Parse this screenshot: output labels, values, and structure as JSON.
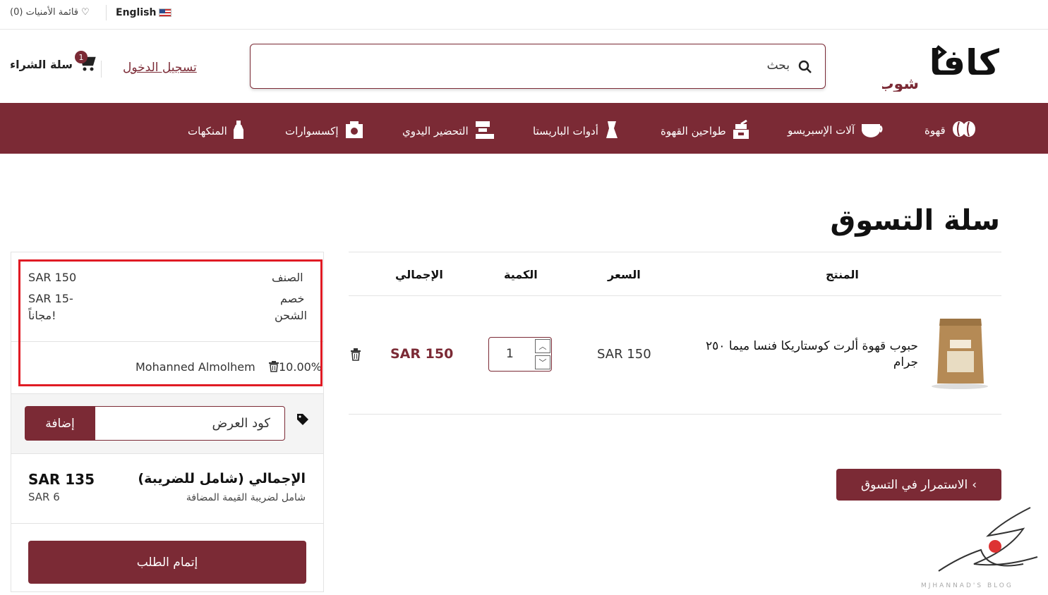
{
  "topbar": {
    "wishlist": "قائمة الأمنيات (0)",
    "language": "English"
  },
  "header": {
    "logo_top": "كافا",
    "logo_bottom": "شوب",
    "search_placeholder": "بحث",
    "login": "تسجيل الدخول",
    "cart_label": "سلة الشراء",
    "cart_count": "1"
  },
  "nav": [
    {
      "label": "قهوة",
      "icon": "coffee-beans-icon"
    },
    {
      "label": "آلات الإسبريسو",
      "icon": "coffee-cup-icon"
    },
    {
      "label": "طواحين القهوة",
      "icon": "grinder-icon"
    },
    {
      "label": "أدوات الباريستا",
      "icon": "milk-pitcher-icon"
    },
    {
      "label": "التحضير اليدوي",
      "icon": "manual-brew-icon"
    },
    {
      "label": "إكسسوارات",
      "icon": "scale-icon"
    },
    {
      "label": "المنكهات",
      "icon": "syrup-bottle-icon"
    }
  ],
  "page_title": "سلة التسوق",
  "table": {
    "headers": {
      "product": "المنتج",
      "price": "السعر",
      "quantity": "الكمية",
      "total": "الإجمالي"
    },
    "rows": [
      {
        "name": "حبوب قهوة ألرت كوستاريكا فنسا ميما ٢٥٠ جرام",
        "price": "SAR 150",
        "quantity": "1",
        "total": "SAR 150"
      }
    ]
  },
  "continue_shopping": "الاستمرار في التسوق",
  "summary": {
    "subtotal_label": "الصنف",
    "subtotal_value": "SAR 150",
    "discount_label": "خصم",
    "discount_value": "SAR 15-",
    "shipping_label": "الشحن",
    "shipping_value": "مجاناً!",
    "coupon_name": "Mohanned Almolhem",
    "coupon_percent": "10.00%",
    "promo_placeholder": "كود العرض",
    "promo_button": "إضافة",
    "total_label": "الإجمالي (شامل للضريبة)",
    "total_value": "SAR 135",
    "vat_label": "شامل لضريبة القيمة المضافة",
    "vat_value": "SAR 6",
    "checkout": "إتمام الطلب"
  },
  "watermark_text": "MJHANNAD'S BLOG",
  "colors": {
    "brand": "#7b2a35",
    "highlight": "#e01b24"
  }
}
